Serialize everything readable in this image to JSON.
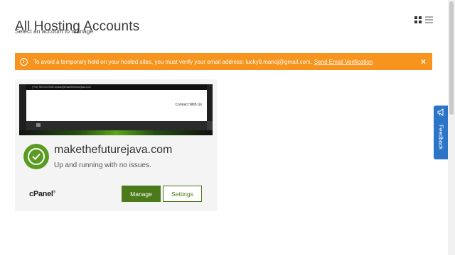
{
  "header": {
    "title": "All Hosting Accounts",
    "subtitle": "Select an account to manage"
  },
  "view_toggle": {
    "grid_icon": "grid-view-icon",
    "list_icon": "list-view-icon"
  },
  "alert": {
    "icon_glyph": "i",
    "message": "To avoid a temporary hold on your hosted sites, you must verify your email address: lucky9.manoj@gmail.com.",
    "link_text": "Send Email Verification",
    "close_glyph": "×",
    "color": "#f7941d"
  },
  "accounts": [
    {
      "preview": {
        "topbar_text": "(+91) 789 234 0000    contact@makethefuturejava.com",
        "nav_text": "Connect With Us"
      },
      "domain": "makethefuturejava.com",
      "status": "Up and running with no issues.",
      "status_color": "#5a9b22",
      "panel_logo": "cPanel",
      "panel_logo_mark": "®",
      "manage_label": "Manage",
      "settings_label": "Settings"
    }
  ],
  "feedback": {
    "label": "Feedback",
    "color": "#2a75c7"
  }
}
